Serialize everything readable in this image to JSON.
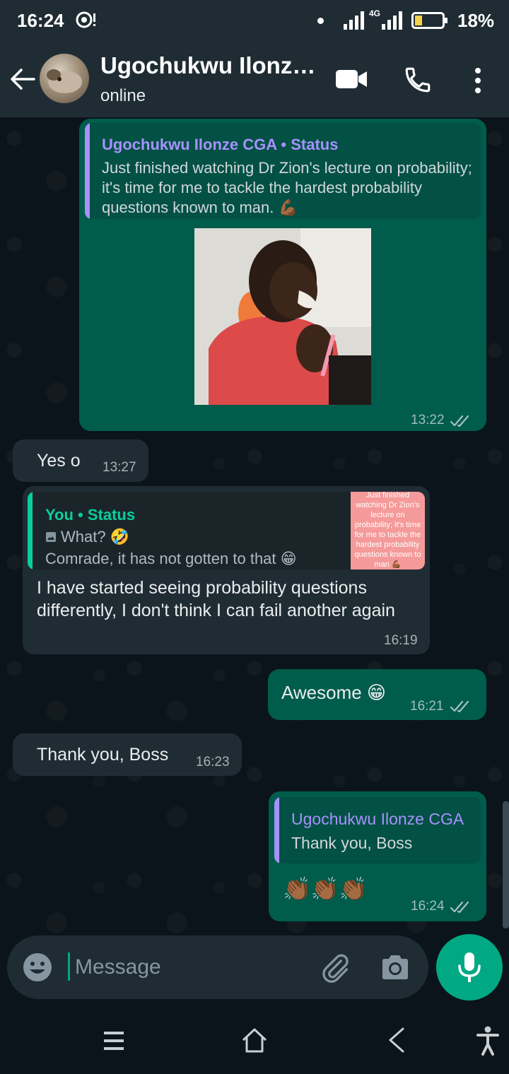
{
  "status_bar": {
    "time": "16:24",
    "network": "4G",
    "battery": "18%"
  },
  "header": {
    "name": "Ugochukwu Ilonz…",
    "status": "online"
  },
  "messages": {
    "status_reply": {
      "quote_author": "Ugochukwu Ilonze CGA • Status",
      "quote_text": "Just finished watching Dr Zion's lecture on probability; it's time for me to tackle the hardest probability questions known to man. 💪🏾",
      "time": "13:22"
    },
    "yes_o": {
      "text": "Yes o",
      "time": "13:27"
    },
    "reply_you_status": {
      "quote_author": "You • Status",
      "quote_line1": "What? 🤣",
      "quote_line2": "Comrade, it has not gotten to that 😁",
      "thumb_text": "Just finished watching Dr Zion's lecture on probability; it's time for me to tackle the hardest probability questions known to man 💪🏾",
      "text": "I have started seeing probability questions differently, I don't think I can fail another again",
      "time": "16:19"
    },
    "awesome": {
      "text": "Awesome 😁",
      "time": "16:21"
    },
    "thank_you": {
      "text": "Thank you, Boss",
      "time": "16:23"
    },
    "last_reply": {
      "quote_author": "Ugochukwu Ilonze CGA",
      "quote_text": "Thank you, Boss",
      "text": "👏🏾👏🏾👏🏾",
      "time": "16:24"
    }
  },
  "input": {
    "placeholder": "Message"
  },
  "colors": {
    "outgoing": "#005c4b",
    "incoming": "#202c33",
    "accent": "#00a884",
    "quote_purple": "#a791ff",
    "quote_green": "#06cf9c"
  }
}
